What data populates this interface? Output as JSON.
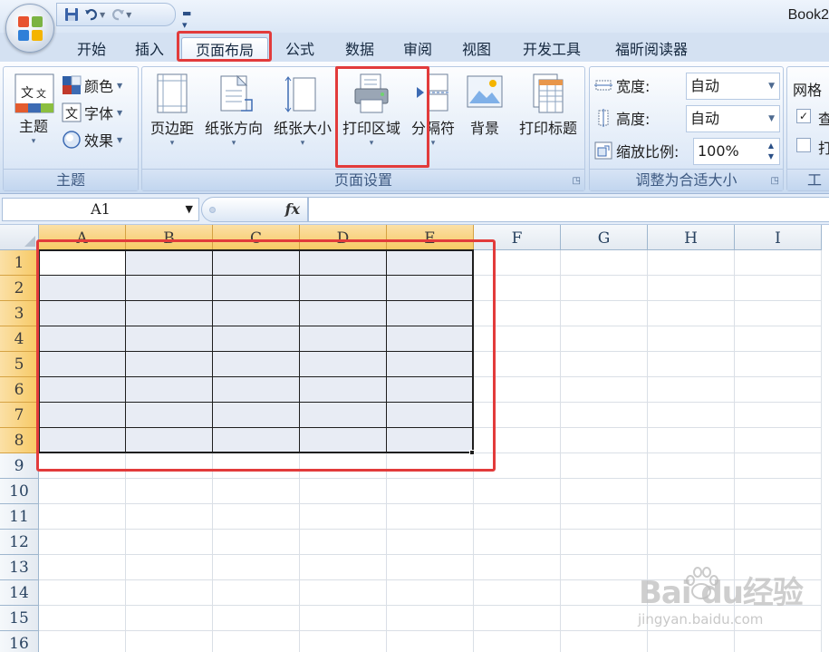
{
  "window": {
    "title": "Book2"
  },
  "tabs": [
    {
      "label": "开始",
      "active": false
    },
    {
      "label": "插入",
      "active": false
    },
    {
      "label": "页面布局",
      "active": true
    },
    {
      "label": "公式",
      "active": false
    },
    {
      "label": "数据",
      "active": false
    },
    {
      "label": "审阅",
      "active": false
    },
    {
      "label": "视图",
      "active": false
    },
    {
      "label": "开发工具",
      "active": false
    },
    {
      "label": "福昕阅读器",
      "active": false
    }
  ],
  "ribbon": {
    "theme_group": {
      "label": "主题",
      "themes_button": "主题",
      "colors": "颜色",
      "fonts": "字体",
      "effects": "效果"
    },
    "page_setup_group": {
      "label": "页面设置",
      "margins": "页边距",
      "orientation": "纸张方向",
      "size": "纸张大小",
      "print_area": "打印区域",
      "breaks": "分隔符",
      "background": "背景",
      "print_titles": "打印标题"
    },
    "scale_group": {
      "label": "调整为合适大小",
      "width_label": "宽度:",
      "width_value": "自动",
      "height_label": "高度:",
      "height_value": "自动",
      "scale_label": "缩放比例:",
      "scale_value": "100%"
    },
    "sheet_options_group": {
      "label": "工",
      "gridlines_label": "网格",
      "view_label": "查",
      "print_label": "打",
      "view_checked": true,
      "print_checked": false
    }
  },
  "formula_bar": {
    "name_box": "A1",
    "fx": "fx",
    "formula": ""
  },
  "sheet": {
    "columns": [
      "A",
      "B",
      "C",
      "D",
      "E",
      "F",
      "G",
      "H",
      "I"
    ],
    "rows": [
      "1",
      "2",
      "3",
      "4",
      "5",
      "6",
      "7",
      "8",
      "9",
      "10",
      "11",
      "12",
      "13",
      "14",
      "15",
      "16"
    ],
    "selected_columns": [
      "A",
      "B",
      "C",
      "D",
      "E"
    ],
    "selected_rows": [
      "1",
      "2",
      "3",
      "4",
      "5",
      "6",
      "7",
      "8"
    ],
    "active_cell": "A1"
  },
  "watermark": {
    "main": "Bai du经验",
    "sub": "jingyan.baidu.com"
  },
  "colors": {
    "highlight": "#e23b3b",
    "selection_header": "#f7c964",
    "selection_fill": "#e8ecf4"
  }
}
